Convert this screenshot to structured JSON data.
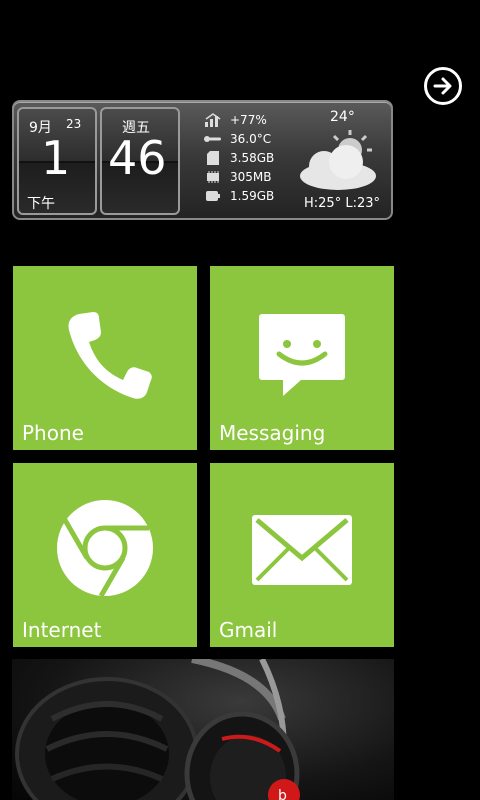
{
  "nav": {
    "next_icon": "arrow-right-circle-icon"
  },
  "widget": {
    "date": {
      "month": "9月",
      "day_small": "23",
      "day_big": "1",
      "ampm": "下午"
    },
    "time": {
      "weekday": "週五",
      "minutes": "46"
    },
    "stats": [
      {
        "icon": "signal-icon",
        "value": "+77%"
      },
      {
        "icon": "thermometer-icon",
        "value": "36.0°C"
      },
      {
        "icon": "sd-card-icon",
        "value": "3.58GB"
      },
      {
        "icon": "memory-icon",
        "value": "305MB"
      },
      {
        "icon": "battery-icon",
        "value": "1.59GB"
      }
    ],
    "weather": {
      "temp": "24°",
      "hilo": "H:25° L:23°",
      "icon": "partly-cloudy-icon"
    }
  },
  "tiles": [
    {
      "label": "Phone",
      "icon": "phone-icon"
    },
    {
      "label": "Messaging",
      "icon": "message-icon"
    },
    {
      "label": "Internet",
      "icon": "chrome-icon"
    },
    {
      "label": "Gmail",
      "icon": "mail-icon"
    }
  ],
  "colors": {
    "tile": "#8cc63e",
    "background": "#000000"
  }
}
